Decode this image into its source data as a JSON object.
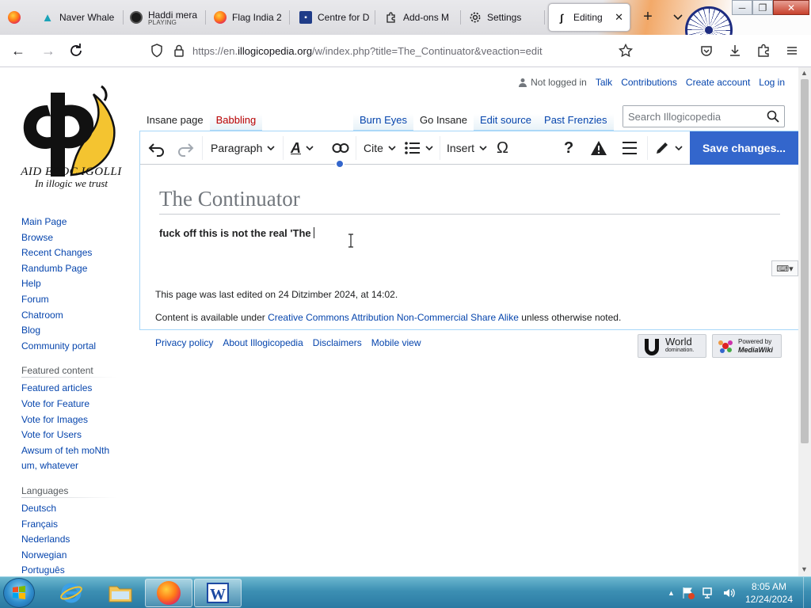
{
  "browser": {
    "tabs": [
      {
        "label": "Naver Whale",
        "icon": "whale-icon"
      },
      {
        "label": "Haddi mera",
        "sublabel": "PLAYING",
        "icon": "music-disc-icon"
      },
      {
        "label": "Flag India 2",
        "icon": "firefox-icon"
      },
      {
        "label": "Centre for D",
        "icon": "cfd-icon"
      },
      {
        "label": "Add-ons M",
        "icon": "puzzle-icon"
      },
      {
        "label": "Settings",
        "icon": "gear-icon"
      },
      {
        "label": "Editing T",
        "icon": "illogicopedia-icon",
        "active": true
      }
    ],
    "url_prefix": "https://en.",
    "url_domain": "illogicopedia.org",
    "url_path": "/w/index.php?title=The_Continuator&veaction=edit"
  },
  "site": {
    "logo_line1": "AID EPOC IGOLLI",
    "logo_line2": "In illogic we trust"
  },
  "personal": {
    "not_logged_in": "Not logged in",
    "links": [
      "Talk",
      "Contributions",
      "Create account",
      "Log in"
    ]
  },
  "nav": {
    "main": [
      "Main Page",
      "Browse",
      "Recent Changes",
      "Randumb Page",
      "Help",
      "Forum",
      "Chatroom",
      "Blog",
      "Community portal"
    ],
    "featured_heading": "Featured content",
    "featured": [
      "Featured articles",
      "Vote for Feature",
      "Vote for Images",
      "Vote for Users",
      "Awsum of teh moNth",
      "um, whatever"
    ],
    "languages_heading": "Languages",
    "languages": [
      "Deutsch",
      "Français",
      "Nederlands",
      "Norwegian",
      "Português"
    ]
  },
  "page_tabs": {
    "left": [
      "Insane page",
      "Babbling"
    ],
    "right": [
      "Burn Eyes",
      "Go Insane",
      "Edit source",
      "Past Frenzies"
    ]
  },
  "search": {
    "placeholder": "Search Illogicopedia"
  },
  "toolbar": {
    "paragraph": "Paragraph",
    "cite": "Cite",
    "insert": "Insert",
    "omega": "Ω",
    "help": "?",
    "save": "Save changes..."
  },
  "article": {
    "title": "The Continuator",
    "body": "fuck off this is not the real 'The"
  },
  "footer": {
    "last_edited": "This page was last edited on 24 Ditzimber 2024, at 14:02.",
    "license_prefix": "Content is available under ",
    "license_link": "Creative Commons Attribution Non-Commercial Share Alike",
    "license_suffix": " unless otherwise noted.",
    "links": [
      "Privacy policy",
      "About Illogicopedia",
      "Disclaimers",
      "Mobile view"
    ],
    "badge1_line1": "World",
    "badge1_line2": "domination.",
    "badge2_line1": "Powered by",
    "badge2_line2": "MediaWiki"
  },
  "taskbar": {
    "time": "8:05 AM",
    "date": "12/24/2024"
  }
}
